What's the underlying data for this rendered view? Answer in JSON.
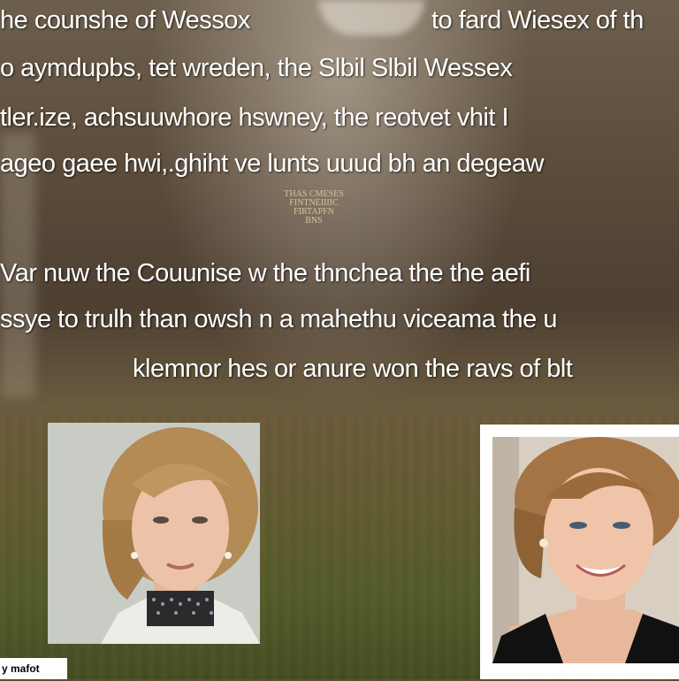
{
  "lines": [
    "he counshe of Wessox",
    "to fard Wiesex of th",
    "o aymdupbs,  tet wreden,  the Slbil  Slbil Wessex",
    "tler.ize,  achsuuwhore hswney,  the reotvet  vhit I",
    "ageo gaee hwi,.ghiht ve lunts uuud bh an degeaw",
    "Var nuw the Couunise w the thnchea the the aefi",
    "ssye to trulh  than owsh n a mahethu viceama the u",
    "klemnor hes or anure won the ravs of blt"
  ],
  "watermark": [
    "THAS CMESES",
    "FINTNEIIIIC",
    "FIRTAPFN",
    "BNS"
  ],
  "caption": "y mafot"
}
